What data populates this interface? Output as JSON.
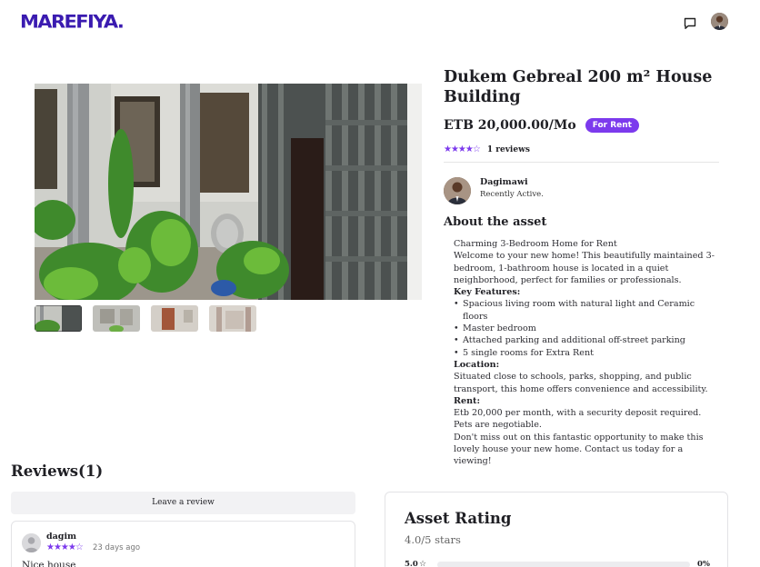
{
  "header": {
    "logo": "MAREFIYA.",
    "chat_icon": "chat-icon",
    "avatar_icon": "user-avatar"
  },
  "gallery": {
    "main_alt": "house-photo",
    "thumbnails": [
      "thumb-1",
      "thumb-2",
      "thumb-3",
      "thumb-4"
    ]
  },
  "listing": {
    "title": "Dukem Gebreal 200 m² House Building",
    "price": "ETB 20,000.00/Mo",
    "badge": "For Rent",
    "rating_stars": "★★★★☆",
    "rating_value": 4,
    "reviews_count": "1 reviews"
  },
  "owner": {
    "name": "Dagimawi",
    "status": "Recently Active."
  },
  "about": {
    "heading": "About the asset",
    "intro_line1": "Charming 3-Bedroom Home for Rent",
    "intro_line2": "Welcome to your new home! This beautifully maintained 3-bedroom, 1-bathroom house is located in a quiet neighborhood, perfect for families or professionals.",
    "features_heading": "Key Features:",
    "features": [
      "Spacious living room with natural light and Ceramic floors",
      "Master bedroom",
      "Attached parking and additional off-street parking",
      "5 single rooms for Extra Rent"
    ],
    "location_heading": "Location:",
    "location_text": "Situated close to schools, parks, shopping, and public transport, this home offers convenience and accessibility.",
    "rent_heading": "Rent:",
    "rent_text": "Etb 20,000 per month, with a security deposit required. Pets are negotiable.",
    "closing": "Don't miss out on this fantastic opportunity to make this lovely house your new home. Contact us today for a viewing!"
  },
  "reviews": {
    "heading": "Reviews(1)",
    "leave_button": "Leave a review",
    "items": [
      {
        "author": "dagim",
        "stars": "★★★★☆",
        "rating": 4,
        "date": "23 days ago",
        "text": "Nice house"
      }
    ]
  },
  "asset_rating": {
    "heading": "Asset Rating",
    "summary": "4.0/5 stars",
    "rows": [
      {
        "label": "5.0",
        "star": "☆",
        "fraction": 0,
        "percent": "0%"
      }
    ]
  },
  "colors": {
    "brand": "#3a1bb0",
    "accent": "#7c3aed"
  }
}
